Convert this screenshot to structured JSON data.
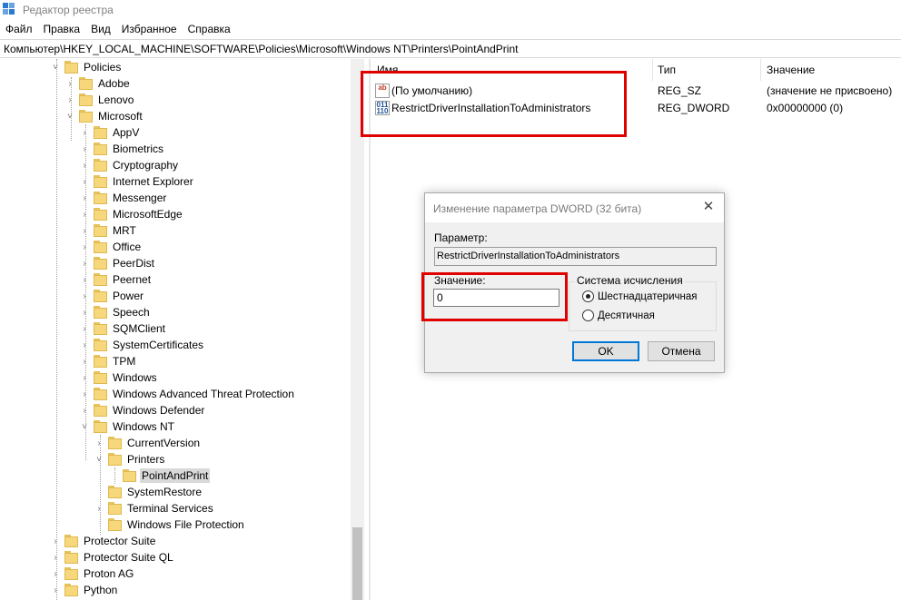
{
  "window": {
    "title": "Редактор реестра",
    "accent": "#2b78d0"
  },
  "menu": [
    "Файл",
    "Правка",
    "Вид",
    "Избранное",
    "Справка"
  ],
  "address": "Компьютер\\HKEY_LOCAL_MACHINE\\SOFTWARE\\Policies\\Microsoft\\Windows NT\\Printers\\PointAndPrint",
  "tree": [
    {
      "label": "Policies",
      "chev": "˅"
    },
    {
      "label": "Adobe",
      "chev": "›"
    },
    {
      "label": "Lenovo",
      "chev": "›"
    },
    {
      "label": "Microsoft",
      "chev": "˅"
    },
    {
      "label": "AppV",
      "chev": "›"
    },
    {
      "label": "Biometrics",
      "chev": "›"
    },
    {
      "label": "Cryptography",
      "chev": "›"
    },
    {
      "label": "Internet Explorer",
      "chev": "›"
    },
    {
      "label": "Messenger",
      "chev": "›"
    },
    {
      "label": "MicrosoftEdge",
      "chev": "›"
    },
    {
      "label": "MRT",
      "chev": "›"
    },
    {
      "label": "Office",
      "chev": "›"
    },
    {
      "label": "PeerDist",
      "chev": "›"
    },
    {
      "label": "Peernet",
      "chev": "›"
    },
    {
      "label": "Power",
      "chev": "›"
    },
    {
      "label": "Speech",
      "chev": "›"
    },
    {
      "label": "SQMClient",
      "chev": "›"
    },
    {
      "label": "SystemCertificates",
      "chev": "›"
    },
    {
      "label": "TPM",
      "chev": "›"
    },
    {
      "label": "Windows",
      "chev": "›"
    },
    {
      "label": "Windows Advanced Threat Protection",
      "chev": "›"
    },
    {
      "label": "Windows Defender",
      "chev": "›"
    },
    {
      "label": "Windows NT",
      "chev": "˅"
    },
    {
      "label": "CurrentVersion",
      "chev": "›"
    },
    {
      "label": "Printers",
      "chev": "˅"
    },
    {
      "label": "PointAndPrint",
      "chev": ""
    },
    {
      "label": "SystemRestore",
      "chev": ""
    },
    {
      "label": "Terminal Services",
      "chev": "›"
    },
    {
      "label": "Windows File Protection",
      "chev": ""
    },
    {
      "label": "Protector Suite",
      "chev": "›"
    },
    {
      "label": "Protector Suite QL",
      "chev": "›"
    },
    {
      "label": "Proton AG",
      "chev": "›"
    },
    {
      "label": "Python",
      "chev": "›"
    }
  ],
  "list": {
    "columns": [
      "Имя",
      "Тип",
      "Значение"
    ],
    "rows": [
      {
        "icon": "ab",
        "name": "(По умолчанию)",
        "type": "REG_SZ",
        "value": "(значение не присвоено)"
      },
      {
        "icon": "011\n110",
        "name": "RestrictDriverInstallationToAdministrators",
        "type": "REG_DWORD",
        "value": "0x00000000 (0)"
      }
    ]
  },
  "dialog": {
    "title": "Изменение параметра DWORD (32 бита)",
    "param_label": "Параметр:",
    "param_value": "RestrictDriverInstallationToAdministrators",
    "value_label": "Значение:",
    "value": "0",
    "base_title": "Система исчисления",
    "radio_hex": "Шестнадцатеричная",
    "radio_dec": "Десятичная",
    "ok": "OK",
    "cancel": "Отмена",
    "close": "✕"
  },
  "highlight_color": "#e00000"
}
